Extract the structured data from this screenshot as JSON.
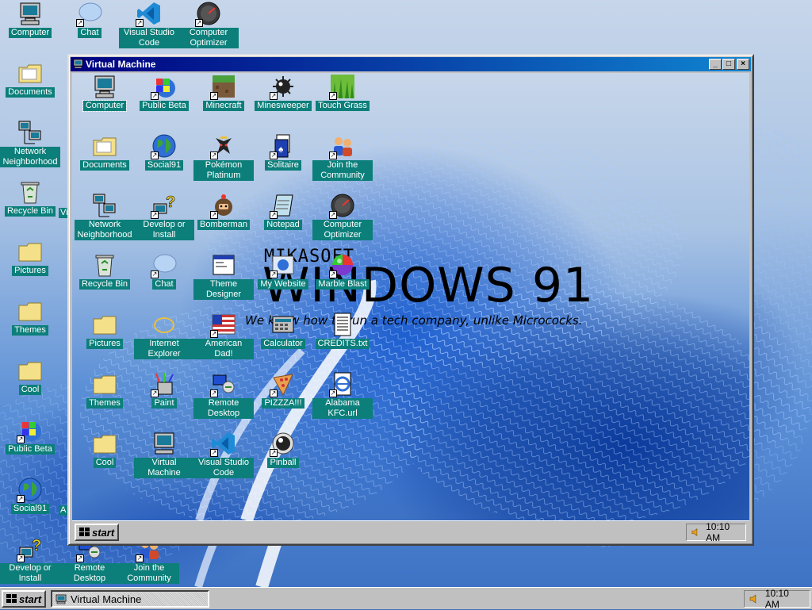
{
  "desktop": {
    "icons": [
      {
        "label": "Computer"
      },
      {
        "label": "Chat"
      },
      {
        "label": "Visual Studio Code"
      },
      {
        "label": "Computer Optimizer"
      },
      {
        "label": "Documents"
      },
      {
        "label": "Network Neighborhood"
      },
      {
        "label": "Recycle Bin"
      },
      {
        "label": "Pictures"
      },
      {
        "label": "Themes"
      },
      {
        "label": "Cool"
      },
      {
        "label": "Public Beta"
      },
      {
        "label": "Social91"
      },
      {
        "label": "Develop or Install"
      },
      {
        "label": "Remote Desktop"
      },
      {
        "label": "Join the Community"
      }
    ],
    "partial_labels": [
      "Vi",
      "A"
    ]
  },
  "window": {
    "title": "Virtual Machine",
    "controls": {
      "minimize": "_",
      "maximize": "□",
      "close": "×"
    },
    "icons": [
      {
        "label": "Computer"
      },
      {
        "label": "Public Beta"
      },
      {
        "label": "Minecraft"
      },
      {
        "label": "Minesweeper"
      },
      {
        "label": "Touch Grass"
      },
      {
        "label": "Documents"
      },
      {
        "label": "Social91"
      },
      {
        "label": "Pokémon Platinum"
      },
      {
        "label": "Solitaire"
      },
      {
        "label": "Join the Community"
      },
      {
        "label": "Network Neighborhood"
      },
      {
        "label": "Develop or Install"
      },
      {
        "label": "Bomberman"
      },
      {
        "label": "Notepad"
      },
      {
        "label": "Computer Optimizer"
      },
      {
        "label": "Recycle Bin"
      },
      {
        "label": "Chat"
      },
      {
        "label": "Theme Designer"
      },
      {
        "label": "My Website"
      },
      {
        "label": "Marble Blast"
      },
      {
        "label": "Pictures"
      },
      {
        "label": "Internet Explorer"
      },
      {
        "label": "American Dad!"
      },
      {
        "label": "Calculator"
      },
      {
        "label": "CREDITS.txt"
      },
      {
        "label": "Themes"
      },
      {
        "label": "Paint"
      },
      {
        "label": "Remote Desktop"
      },
      {
        "label": "PIZZZA!!!"
      },
      {
        "label": "Alabama KFC.url"
      },
      {
        "label": "Cool"
      },
      {
        "label": "Virtual Machine"
      },
      {
        "label": "Visual Studio Code"
      },
      {
        "label": "Pinball"
      }
    ],
    "branding": {
      "small": "MIKASOFT",
      "big": "WINDOWS 91",
      "tagline": "We know how to run a tech company, unlike Micrococks."
    },
    "taskbar": {
      "start": "start",
      "clock": "10:10 AM"
    }
  },
  "taskbar": {
    "start": "start",
    "task": "Virtual Machine",
    "clock": "10:10 AM"
  },
  "colors": {
    "label_bg": "#0c7f7a",
    "title_start": "#000080",
    "title_end": "#1084d0",
    "chrome": "#c0c0c0"
  }
}
